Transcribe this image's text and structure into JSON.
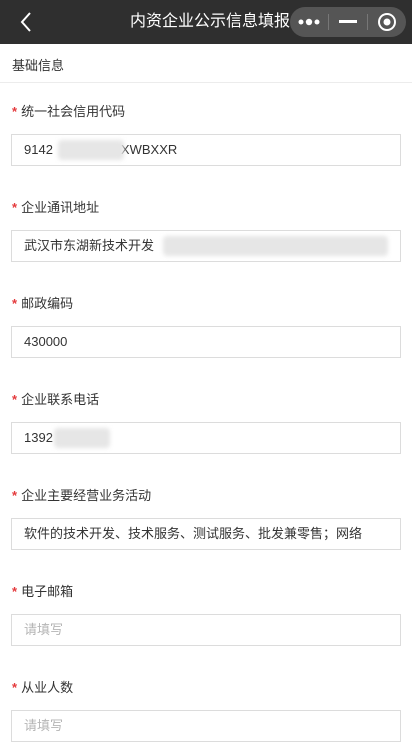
{
  "header": {
    "title": "内资企业公示信息填报",
    "back_icon": "chevron-left-icon",
    "more_icon": "more-dots-icon",
    "minimize_icon": "minimize-icon",
    "close_icon": "target-close-icon"
  },
  "section": {
    "title": "基础信息"
  },
  "form": {
    "required_mark": "*",
    "fields": [
      {
        "label": "统一社会信用代码",
        "value": "9142XWBXXR",
        "value_left": "9142",
        "value_right": "XWBXXR"
      },
      {
        "label": "企业通讯地址",
        "value": "武汉市东湖新技术开发"
      },
      {
        "label": "邮政编码",
        "value": "430000"
      },
      {
        "label": "企业联系电话",
        "value": "1392"
      },
      {
        "label": "企业主要经营业务活动",
        "value": "软件的技术开发、技术服务、测试服务、批发兼零售；网络"
      },
      {
        "label": "电子邮箱",
        "placeholder": "请填写"
      },
      {
        "label": "从业人数",
        "placeholder": "请填写"
      }
    ]
  }
}
